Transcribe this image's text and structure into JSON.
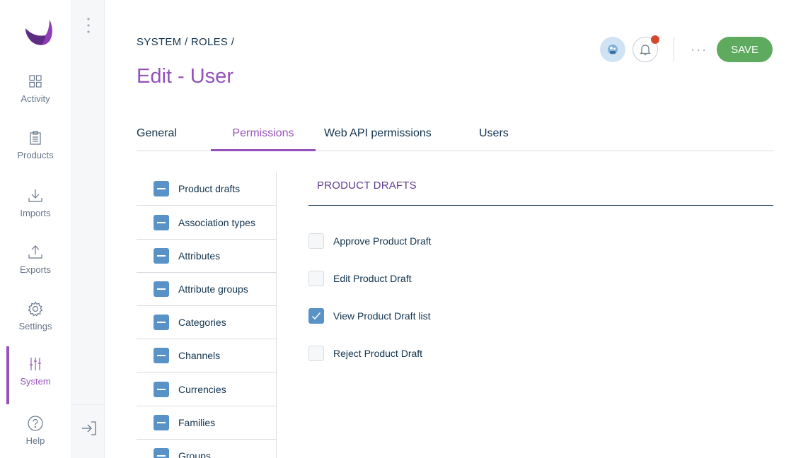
{
  "nav": {
    "items": [
      {
        "label": "Activity",
        "icon": "activity-icon"
      },
      {
        "label": "Products",
        "icon": "products-icon"
      },
      {
        "label": "Imports",
        "icon": "imports-icon"
      },
      {
        "label": "Exports",
        "icon": "exports-icon"
      },
      {
        "label": "Settings",
        "icon": "settings-icon"
      },
      {
        "label": "System",
        "icon": "system-icon",
        "active": true
      },
      {
        "label": "Help",
        "icon": "help-icon"
      }
    ]
  },
  "header": {
    "breadcrumb": "SYSTEM / ROLES /",
    "title": "Edit - User",
    "more_label": "···",
    "save_label": "SAVE"
  },
  "tabs": [
    {
      "label": "General"
    },
    {
      "label": "Permissions",
      "active": true
    },
    {
      "label": "Web API permissions"
    },
    {
      "label": "Users"
    }
  ],
  "resources": [
    {
      "label": "Product drafts"
    },
    {
      "label": "Association types"
    },
    {
      "label": "Attributes"
    },
    {
      "label": "Attribute groups"
    },
    {
      "label": "Categories"
    },
    {
      "label": "Channels"
    },
    {
      "label": "Currencies"
    },
    {
      "label": "Families"
    },
    {
      "label": "Groups"
    }
  ],
  "panel": {
    "title": "PRODUCT DRAFTS",
    "permissions": [
      {
        "label": "Approve Product Draft",
        "checked": false
      },
      {
        "label": "Edit Product Draft",
        "checked": false
      },
      {
        "label": "View Product Draft list",
        "checked": true
      },
      {
        "label": "Reject Product Draft",
        "checked": false
      }
    ]
  },
  "colors": {
    "brand": "#9452ba",
    "save": "#5eaa5e",
    "checkbox": "#5992c7",
    "notification": "#d4472f"
  }
}
